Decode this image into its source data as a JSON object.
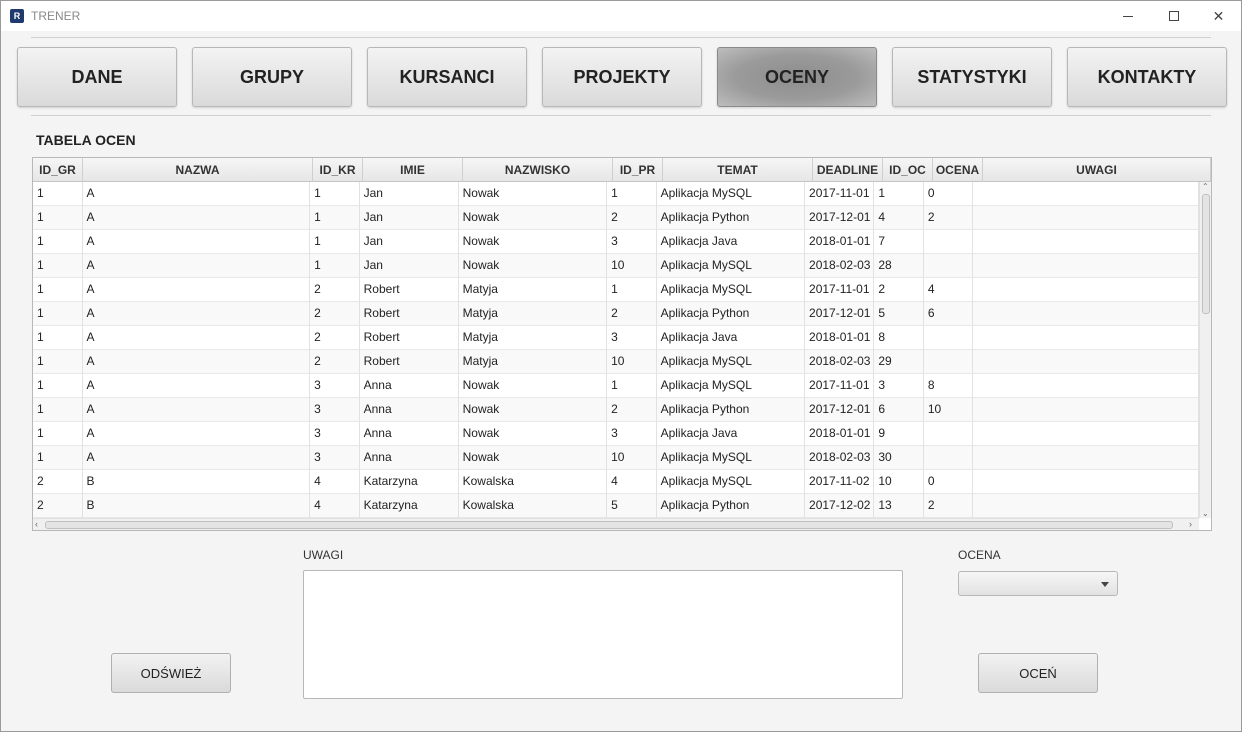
{
  "window": {
    "title": "TRENER",
    "icon_letter": "R"
  },
  "tabs": [
    {
      "label": "DANE"
    },
    {
      "label": "GRUPY"
    },
    {
      "label": "KURSANCI"
    },
    {
      "label": "PROJEKTY"
    },
    {
      "label": "OCENY",
      "active": true
    },
    {
      "label": "STATYSTYKI"
    },
    {
      "label": "KONTAKTY"
    }
  ],
  "table": {
    "title": "TABELA OCEN",
    "columns": [
      "ID_GR",
      "NAZWA",
      "ID_KR",
      "IMIE",
      "NAZWISKO",
      "ID_PR",
      "TEMAT",
      "DEADLINE",
      "ID_OC",
      "OCENA",
      "UWAGI"
    ],
    "rows": [
      [
        "1",
        "A",
        "1",
        "Jan",
        "Nowak",
        "1",
        "Aplikacja MySQL",
        "2017-11-01",
        "1",
        "0",
        ""
      ],
      [
        "1",
        "A",
        "1",
        "Jan",
        "Nowak",
        "2",
        "Aplikacja Python",
        "2017-12-01",
        "4",
        "2",
        ""
      ],
      [
        "1",
        "A",
        "1",
        "Jan",
        "Nowak",
        "3",
        "Aplikacja Java",
        "2018-01-01",
        "7",
        "",
        ""
      ],
      [
        "1",
        "A",
        "1",
        "Jan",
        "Nowak",
        "10",
        "Aplikacja MySQL",
        "2018-02-03",
        "28",
        "",
        ""
      ],
      [
        "1",
        "A",
        "2",
        "Robert",
        "Matyja",
        "1",
        "Aplikacja MySQL",
        "2017-11-01",
        "2",
        "4",
        ""
      ],
      [
        "1",
        "A",
        "2",
        "Robert",
        "Matyja",
        "2",
        "Aplikacja Python",
        "2017-12-01",
        "5",
        "6",
        ""
      ],
      [
        "1",
        "A",
        "2",
        "Robert",
        "Matyja",
        "3",
        "Aplikacja Java",
        "2018-01-01",
        "8",
        "",
        ""
      ],
      [
        "1",
        "A",
        "2",
        "Robert",
        "Matyja",
        "10",
        "Aplikacja MySQL",
        "2018-02-03",
        "29",
        "",
        ""
      ],
      [
        "1",
        "A",
        "3",
        "Anna",
        "Nowak",
        "1",
        "Aplikacja MySQL",
        "2017-11-01",
        "3",
        "8",
        ""
      ],
      [
        "1",
        "A",
        "3",
        "Anna",
        "Nowak",
        "2",
        "Aplikacja Python",
        "2017-12-01",
        "6",
        "10",
        ""
      ],
      [
        "1",
        "A",
        "3",
        "Anna",
        "Nowak",
        "3",
        "Aplikacja Java",
        "2018-01-01",
        "9",
        "",
        ""
      ],
      [
        "1",
        "A",
        "3",
        "Anna",
        "Nowak",
        "10",
        "Aplikacja MySQL",
        "2018-02-03",
        "30",
        "",
        ""
      ],
      [
        "2",
        "B",
        "4",
        "Katarzyna",
        "Kowalska",
        "4",
        "Aplikacja MySQL",
        "2017-11-02",
        "10",
        "0",
        ""
      ],
      [
        "2",
        "B",
        "4",
        "Katarzyna",
        "Kowalska",
        "5",
        "Aplikacja Python",
        "2017-12-02",
        "13",
        "2",
        ""
      ]
    ]
  },
  "form": {
    "uwagi_label": "UWAGI",
    "uwagi_value": "",
    "ocena_label": "OCENA",
    "ocena_value": "",
    "refresh_label": "ODŚWIEŻ",
    "grade_label": "OCEŃ"
  }
}
